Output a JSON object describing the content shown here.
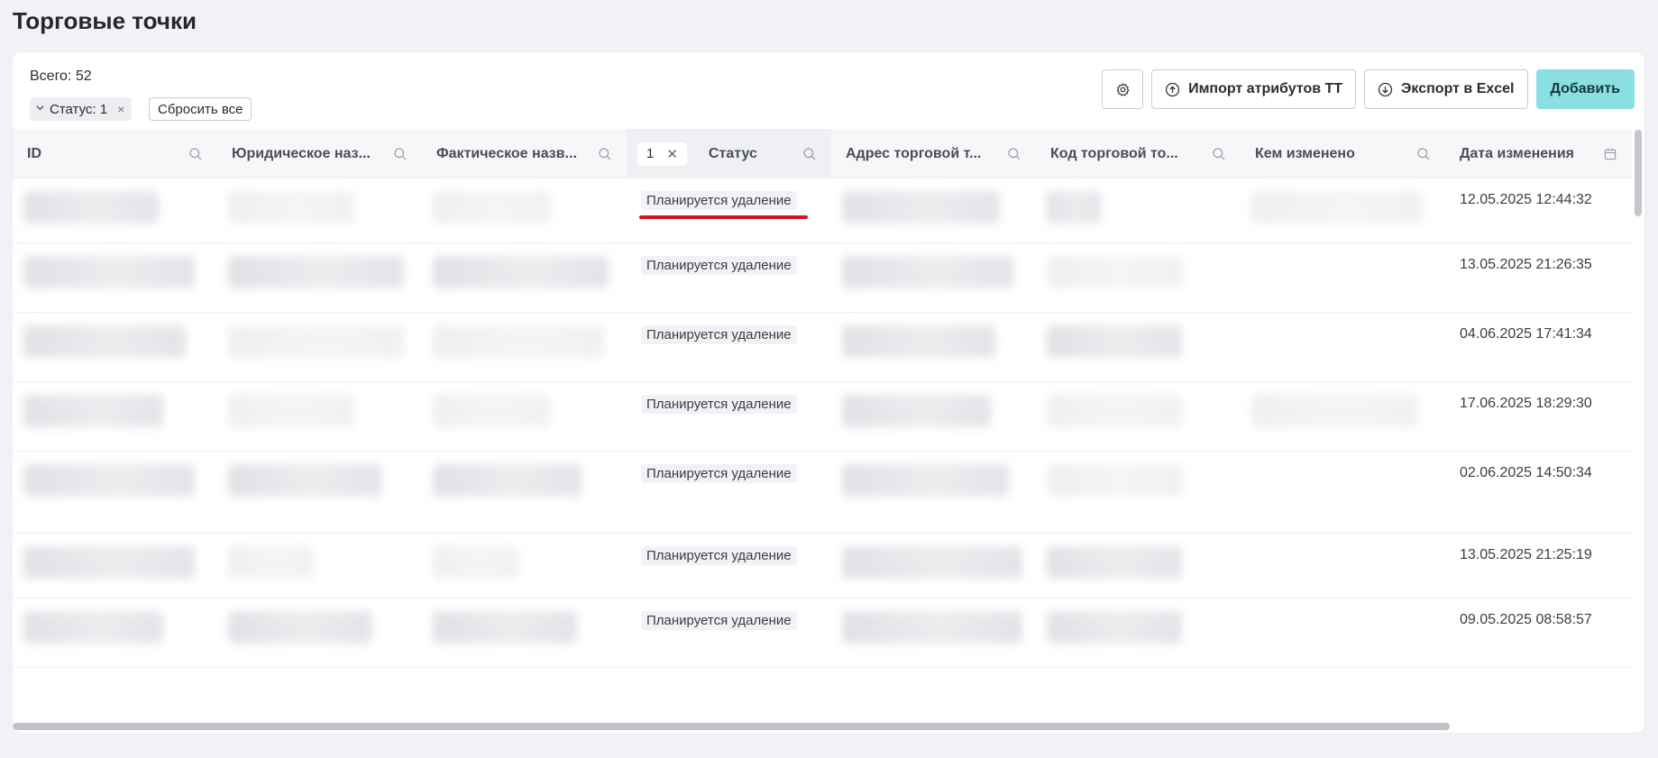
{
  "page": {
    "title": "Торговые точки"
  },
  "summary": {
    "total": "Всего: 52"
  },
  "filters": {
    "chip_label": "Статус: 1",
    "reset_label": "Сбросить все"
  },
  "toolbar": {
    "settings_icon": "gear-icon",
    "import_label": "Импорт атрибутов ТТ",
    "export_label": "Экспорт в Excel",
    "add_label": "Добавить"
  },
  "columns": [
    {
      "label": "ID"
    },
    {
      "label": "Юридическое наз..."
    },
    {
      "label": "Фактическое назв..."
    },
    {
      "label": "Статус",
      "filter_count": "1"
    },
    {
      "label": "Адрес торговой т..."
    },
    {
      "label": "Код торговой то..."
    },
    {
      "label": "Кем изменено"
    },
    {
      "label": "Дата изменения"
    }
  ],
  "rows": [
    {
      "status": "Планируется удаление",
      "changed_at": "12.05.2025 12:44:32"
    },
    {
      "status": "Планируется удаление",
      "changed_at": "13.05.2025 21:26:35"
    },
    {
      "status": "Планируется удаление",
      "changed_at": "04.06.2025 17:41:34"
    },
    {
      "status": "Планируется удаление",
      "changed_at": "17.06.2025 18:29:30"
    },
    {
      "status": "Планируется удаление",
      "changed_at": "02.06.2025 14:50:34"
    },
    {
      "status": "Планируется удаление",
      "changed_at": "13.05.2025 21:25:19"
    },
    {
      "status": "Планируется удаление",
      "changed_at": "09.05.2025 08:58:57"
    }
  ],
  "colors": {
    "primary": "#8adfe3",
    "annotation": "#d4111c"
  }
}
